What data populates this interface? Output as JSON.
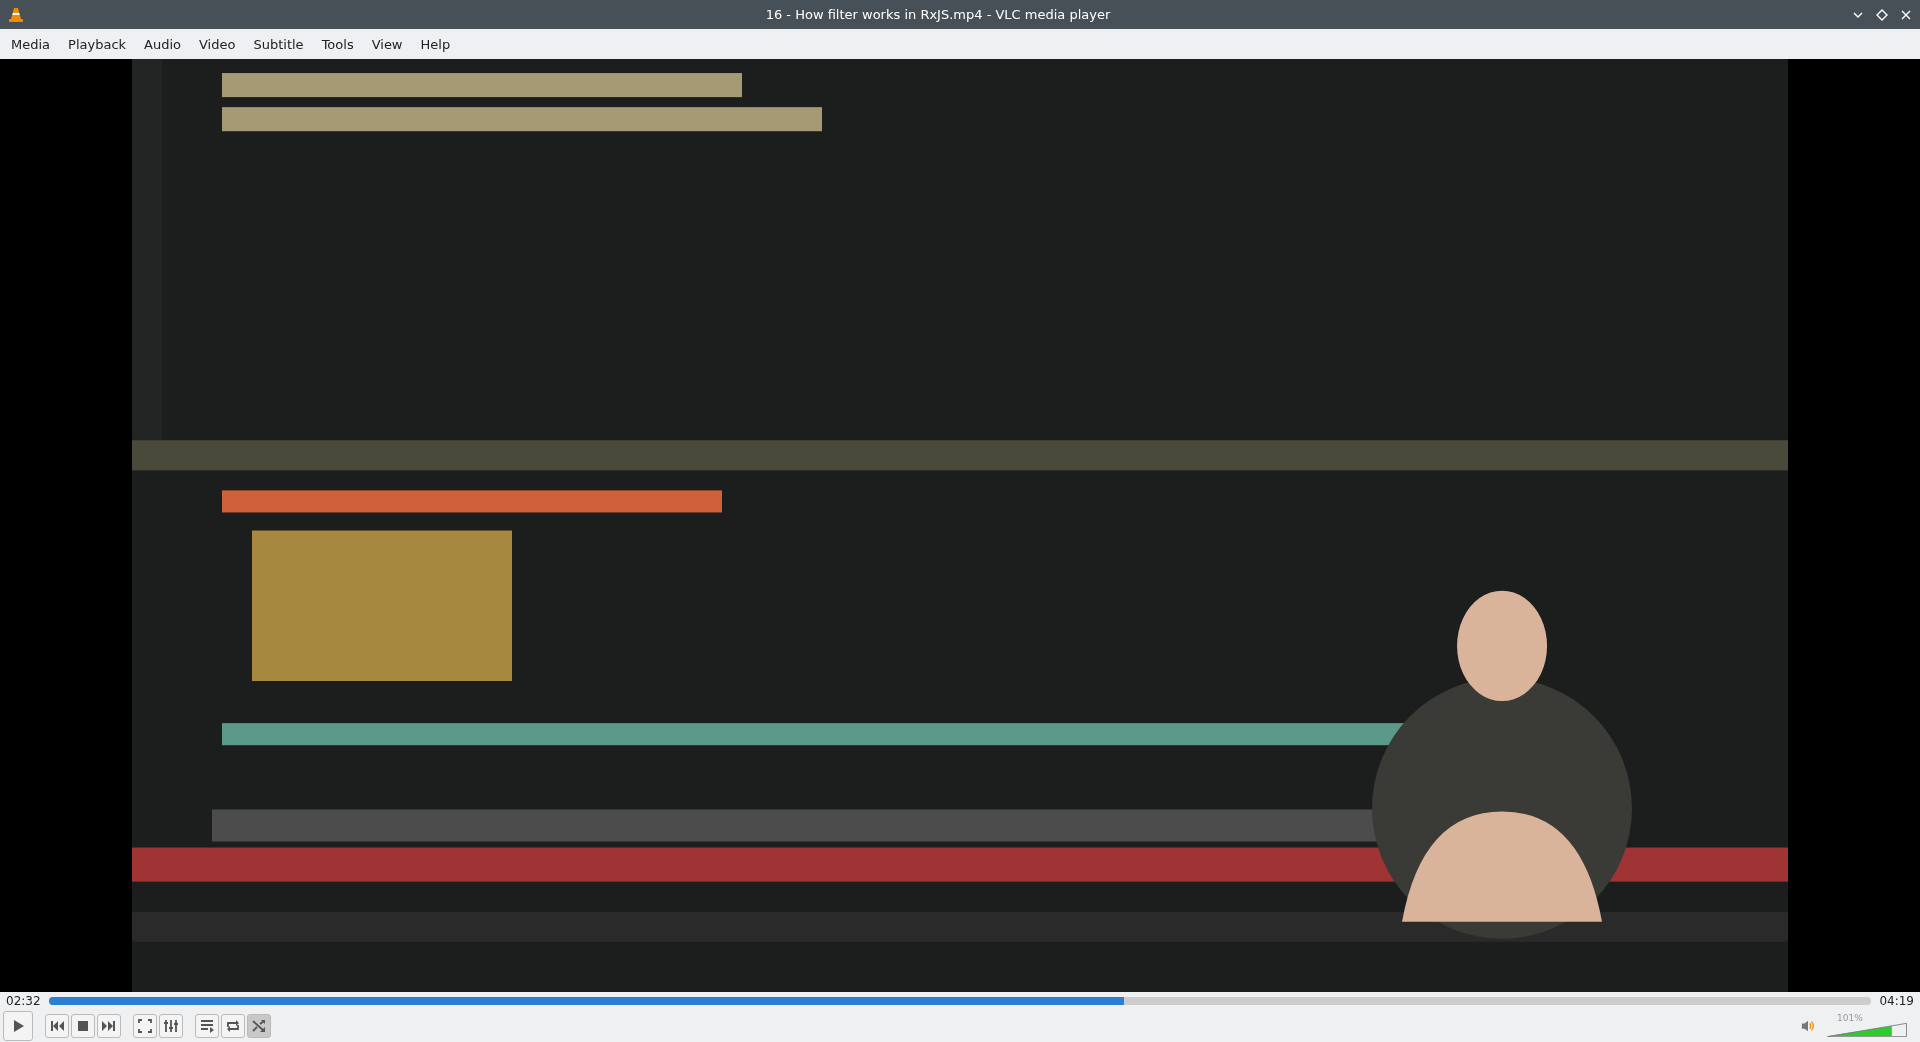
{
  "window": {
    "title": "16 - How filter works in RxJS.mp4 - VLC media player"
  },
  "menu": [
    "Media",
    "Playback",
    "Audio",
    "Video",
    "Subtitle",
    "Tools",
    "View",
    "Help"
  ],
  "video": {
    "kind": "picture"
  },
  "time": {
    "elapsed": "02:32",
    "total": "04:19",
    "level": 0.59
  },
  "controls": [
    {
      "kind": "play",
      "on": false
    },
    {
      "kind": "previous",
      "on": false
    },
    {
      "kind": "stop",
      "on": false
    },
    {
      "kind": "next",
      "on": false
    },
    {
      "kind": "fullscreen",
      "on": false
    },
    {
      "kind": "settings",
      "on": false
    },
    {
      "kind": "playlist",
      "on": false
    },
    {
      "kind": "loop",
      "on": false
    },
    {
      "kind": "shuffle",
      "on": true
    }
  ],
  "volume": {
    "reading": "101%",
    "level": 0.81
  }
}
